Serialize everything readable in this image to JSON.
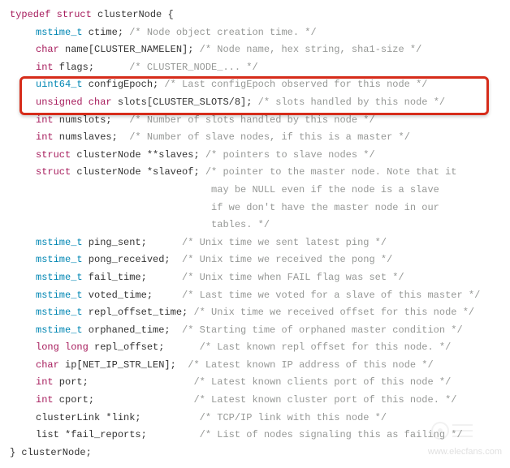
{
  "struct_open": {
    "kw1": "typedef",
    "kw2": "struct",
    "name": "clusterNode {"
  },
  "lines": [
    {
      "type_kw": "",
      "type": "mstime_t",
      "decl": " ctime;",
      "cmt": " /* Node object creation time. */"
    },
    {
      "type_kw": "char",
      "type": "",
      "decl": " name[CLUSTER_NAMELEN];",
      "cmt": " /* Node name, hex string, sha1-size */"
    },
    {
      "type_kw": "int",
      "type": "",
      "decl": " flags;     ",
      "cmt": " /* CLUSTER_NODE_... */"
    },
    {
      "type_kw": "",
      "type": "uint64_t",
      "decl": " configEpoch;",
      "cmt": " /* Last configEpoch observed for this node */"
    },
    {
      "type_kw": "unsigned char",
      "type": "",
      "decl": " slots[CLUSTER_SLOTS/8];",
      "cmt": " /* slots handled by this node */"
    },
    {
      "type_kw": "int",
      "type": "",
      "decl": " numslots;  ",
      "cmt": " /* Number of slots handled by this node */"
    },
    {
      "type_kw": "int",
      "type": "",
      "decl": " numslaves; ",
      "cmt": " /* Number of slave nodes, if this is a master */"
    },
    {
      "type_kw": "struct",
      "type": "",
      "decl": " clusterNode **slaves;",
      "cmt": " /* pointers to slave nodes */"
    },
    {
      "type_kw": "struct",
      "type": "",
      "decl": " clusterNode *slaveof;",
      "cmt": " /* pointer to the master node. Note that it"
    }
  ],
  "slaveof_cont": [
    "                              may be NULL even if the node is a slave",
    "                              if we don't have the master node in our",
    "                              tables. */"
  ],
  "lines2": [
    {
      "type_kw": "",
      "type": "mstime_t",
      "decl": " ping_sent;     ",
      "cmt": " /* Unix time we sent latest ping */"
    },
    {
      "type_kw": "",
      "type": "mstime_t",
      "decl": " pong_received; ",
      "cmt": " /* Unix time we received the pong */"
    },
    {
      "type_kw": "",
      "type": "mstime_t",
      "decl": " fail_time;     ",
      "cmt": " /* Unix time when FAIL flag was set */"
    },
    {
      "type_kw": "",
      "type": "mstime_t",
      "decl": " voted_time;    ",
      "cmt": " /* Last time we voted for a slave of this master */"
    },
    {
      "type_kw": "",
      "type": "mstime_t",
      "decl": " repl_offset_time; ",
      "cmt": "/* Unix time we received offset for this node */"
    },
    {
      "type_kw": "",
      "type": "mstime_t",
      "decl": " orphaned_time; ",
      "cmt": " /* Starting time of orphaned master condition */"
    },
    {
      "type_kw": "long long",
      "type": "",
      "decl": " repl_offset;     ",
      "cmt": " /* Last known repl offset for this node. */"
    },
    {
      "type_kw": "char",
      "type": "",
      "decl": " ip[NET_IP_STR_LEN]; ",
      "cmt": " /* Latest known IP address of this node */"
    },
    {
      "type_kw": "int",
      "type": "",
      "decl": " port;                 ",
      "cmt": " /* Latest known clients port of this node */"
    },
    {
      "type_kw": "int",
      "type": "",
      "decl": " cport;                ",
      "cmt": " /* Latest known cluster port of this node. */"
    },
    {
      "type_kw": "",
      "type": "",
      "decl": "clusterLink *link;         ",
      "cmt": " /* TCP/IP link with this node */"
    },
    {
      "type_kw": "",
      "type": "",
      "decl": "list *fail_reports;        ",
      "cmt": " /* List of nodes signaling this as failing */"
    }
  ],
  "struct_close": "} clusterNode;",
  "watermark": "www.elecfans.com"
}
